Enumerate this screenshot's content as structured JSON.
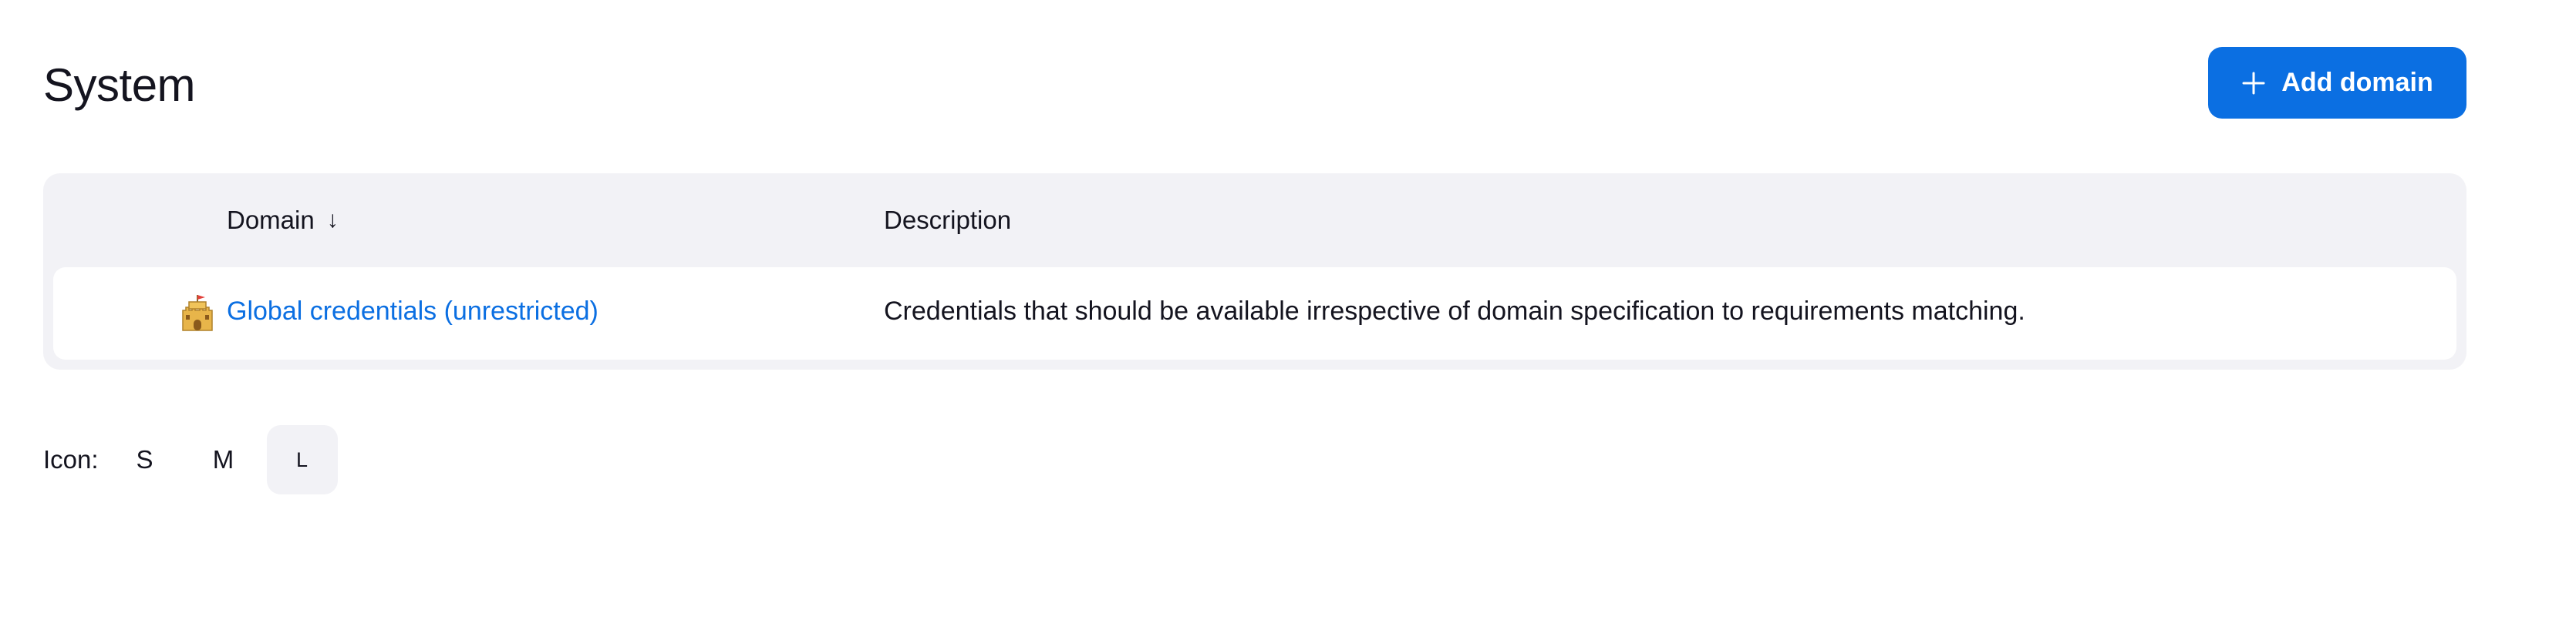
{
  "header": {
    "title": "System",
    "add_button_label": "Add domain",
    "add_button_icon": "plus-icon",
    "accent_color": "#0b6fe2"
  },
  "table": {
    "columns": {
      "domain": "Domain",
      "domain_sort_indicator": "↓",
      "description": "Description"
    },
    "rows": [
      {
        "icon": "castle-icon",
        "domain": "Global credentials (unrestricted)",
        "description": "Credentials that should be available irrespective of domain specification to requirements matching."
      }
    ]
  },
  "icon_size": {
    "label": "Icon:",
    "options": [
      "S",
      "M",
      "L"
    ],
    "selected": "L"
  }
}
